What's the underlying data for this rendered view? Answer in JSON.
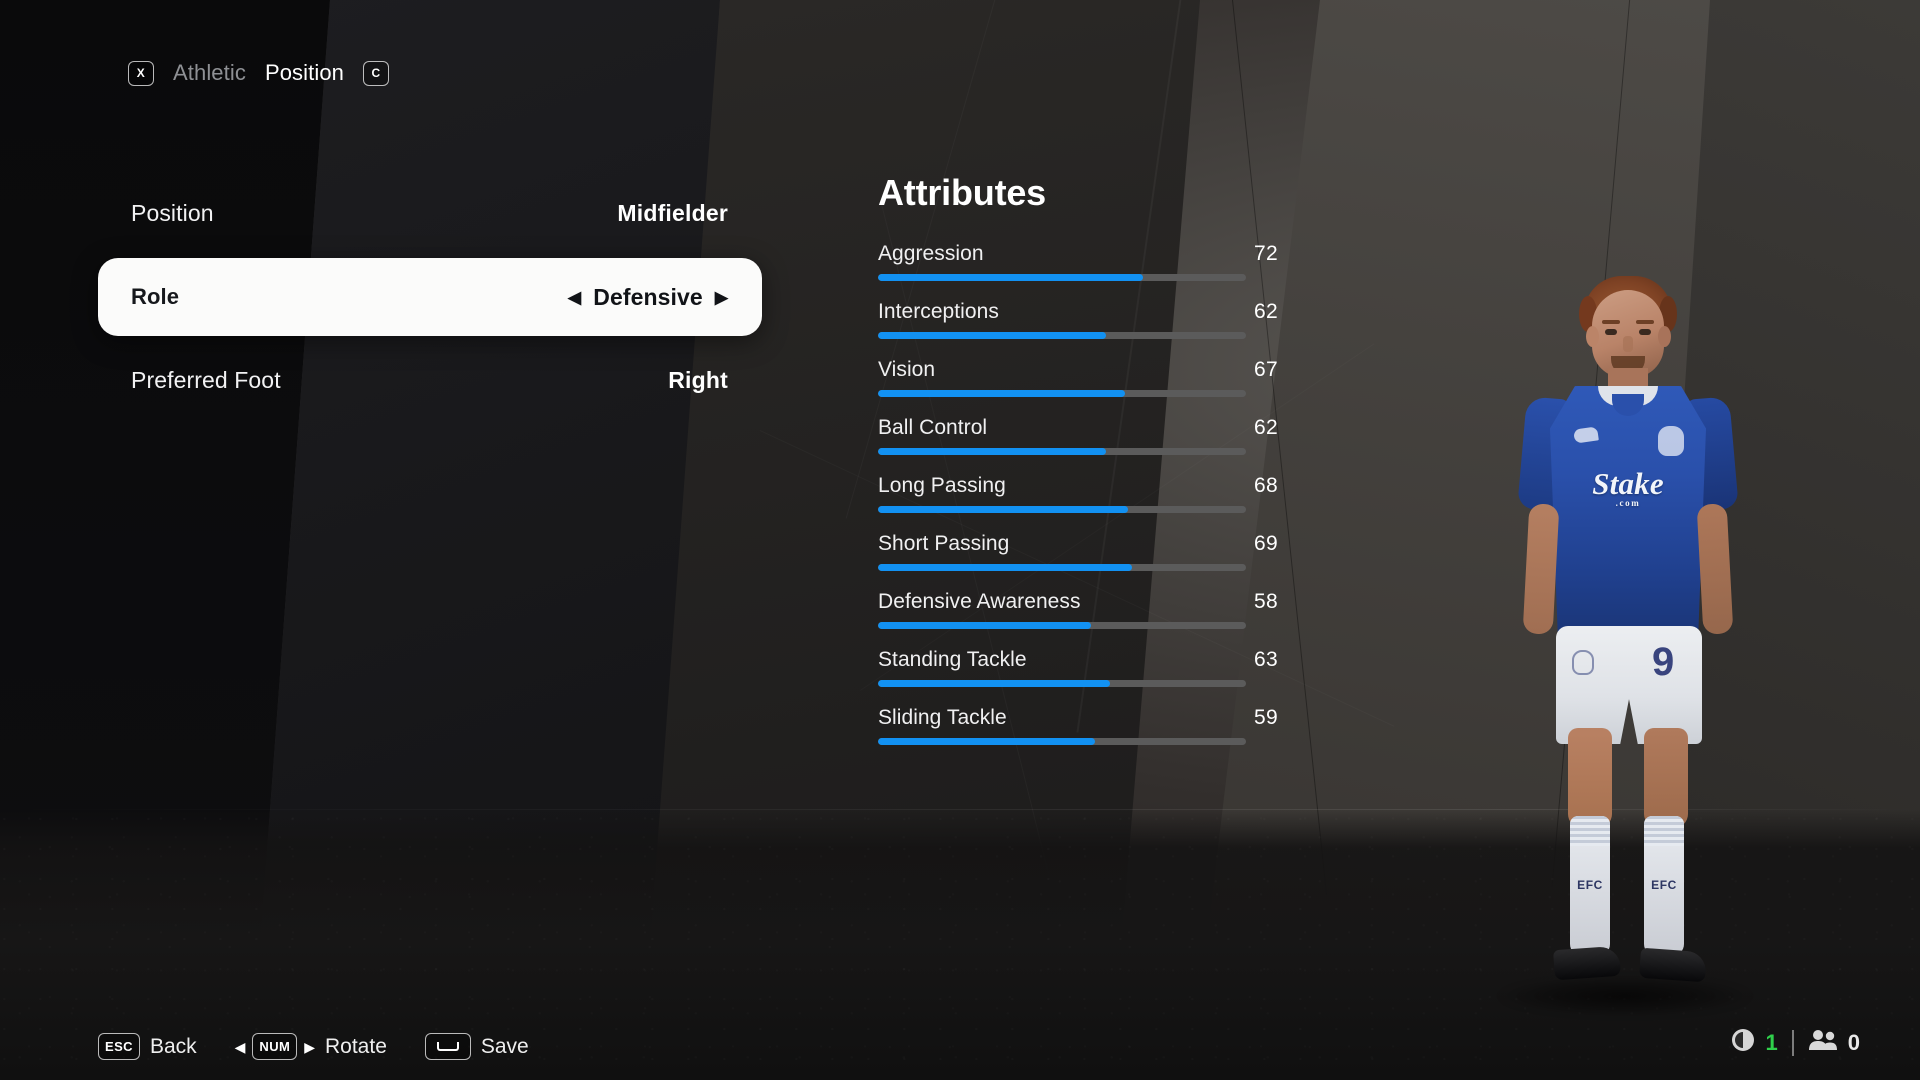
{
  "topnav": {
    "left_key": "X",
    "left_tab": "Athletic",
    "active_tab": "Position",
    "right_key": "C"
  },
  "settings": {
    "rows": [
      {
        "label": "Position",
        "value": "Midfielder",
        "selected": false
      },
      {
        "label": "Role",
        "value": "Defensive",
        "selected": true,
        "left_arrow": "◀",
        "right_arrow": "▶"
      },
      {
        "label": "Preferred Foot",
        "value": "Right",
        "selected": false
      }
    ]
  },
  "attributes": {
    "title": "Attributes",
    "max": 100,
    "items": [
      {
        "name": "Aggression",
        "value": 72
      },
      {
        "name": "Interceptions",
        "value": 62
      },
      {
        "name": "Vision",
        "value": 67
      },
      {
        "name": "Ball Control",
        "value": 62
      },
      {
        "name": "Long Passing",
        "value": 68
      },
      {
        "name": "Short Passing",
        "value": 69
      },
      {
        "name": "Defensive Awareness",
        "value": 58
      },
      {
        "name": "Standing Tackle",
        "value": 63
      },
      {
        "name": "Sliding Tackle",
        "value": 59
      }
    ]
  },
  "player": {
    "kit_sponsor": "Stake",
    "kit_sponsor_sub": ".com",
    "shirt_number": "9",
    "sock_text": "EFC"
  },
  "footer": {
    "hints": [
      {
        "key": "ESC",
        "label": "Back",
        "type": "key"
      },
      {
        "key": "NUM",
        "label": "Rotate",
        "type": "arrows"
      },
      {
        "key": "space",
        "label": "Save",
        "type": "space"
      }
    ]
  },
  "status": {
    "audio_count": "1",
    "friends_count": "0",
    "accent_green": "#2fd04b"
  },
  "colors": {
    "bar_fill": "#1291f2",
    "bar_track": "#5b5b5b",
    "selected_row_bg": "#fbfbfa"
  }
}
